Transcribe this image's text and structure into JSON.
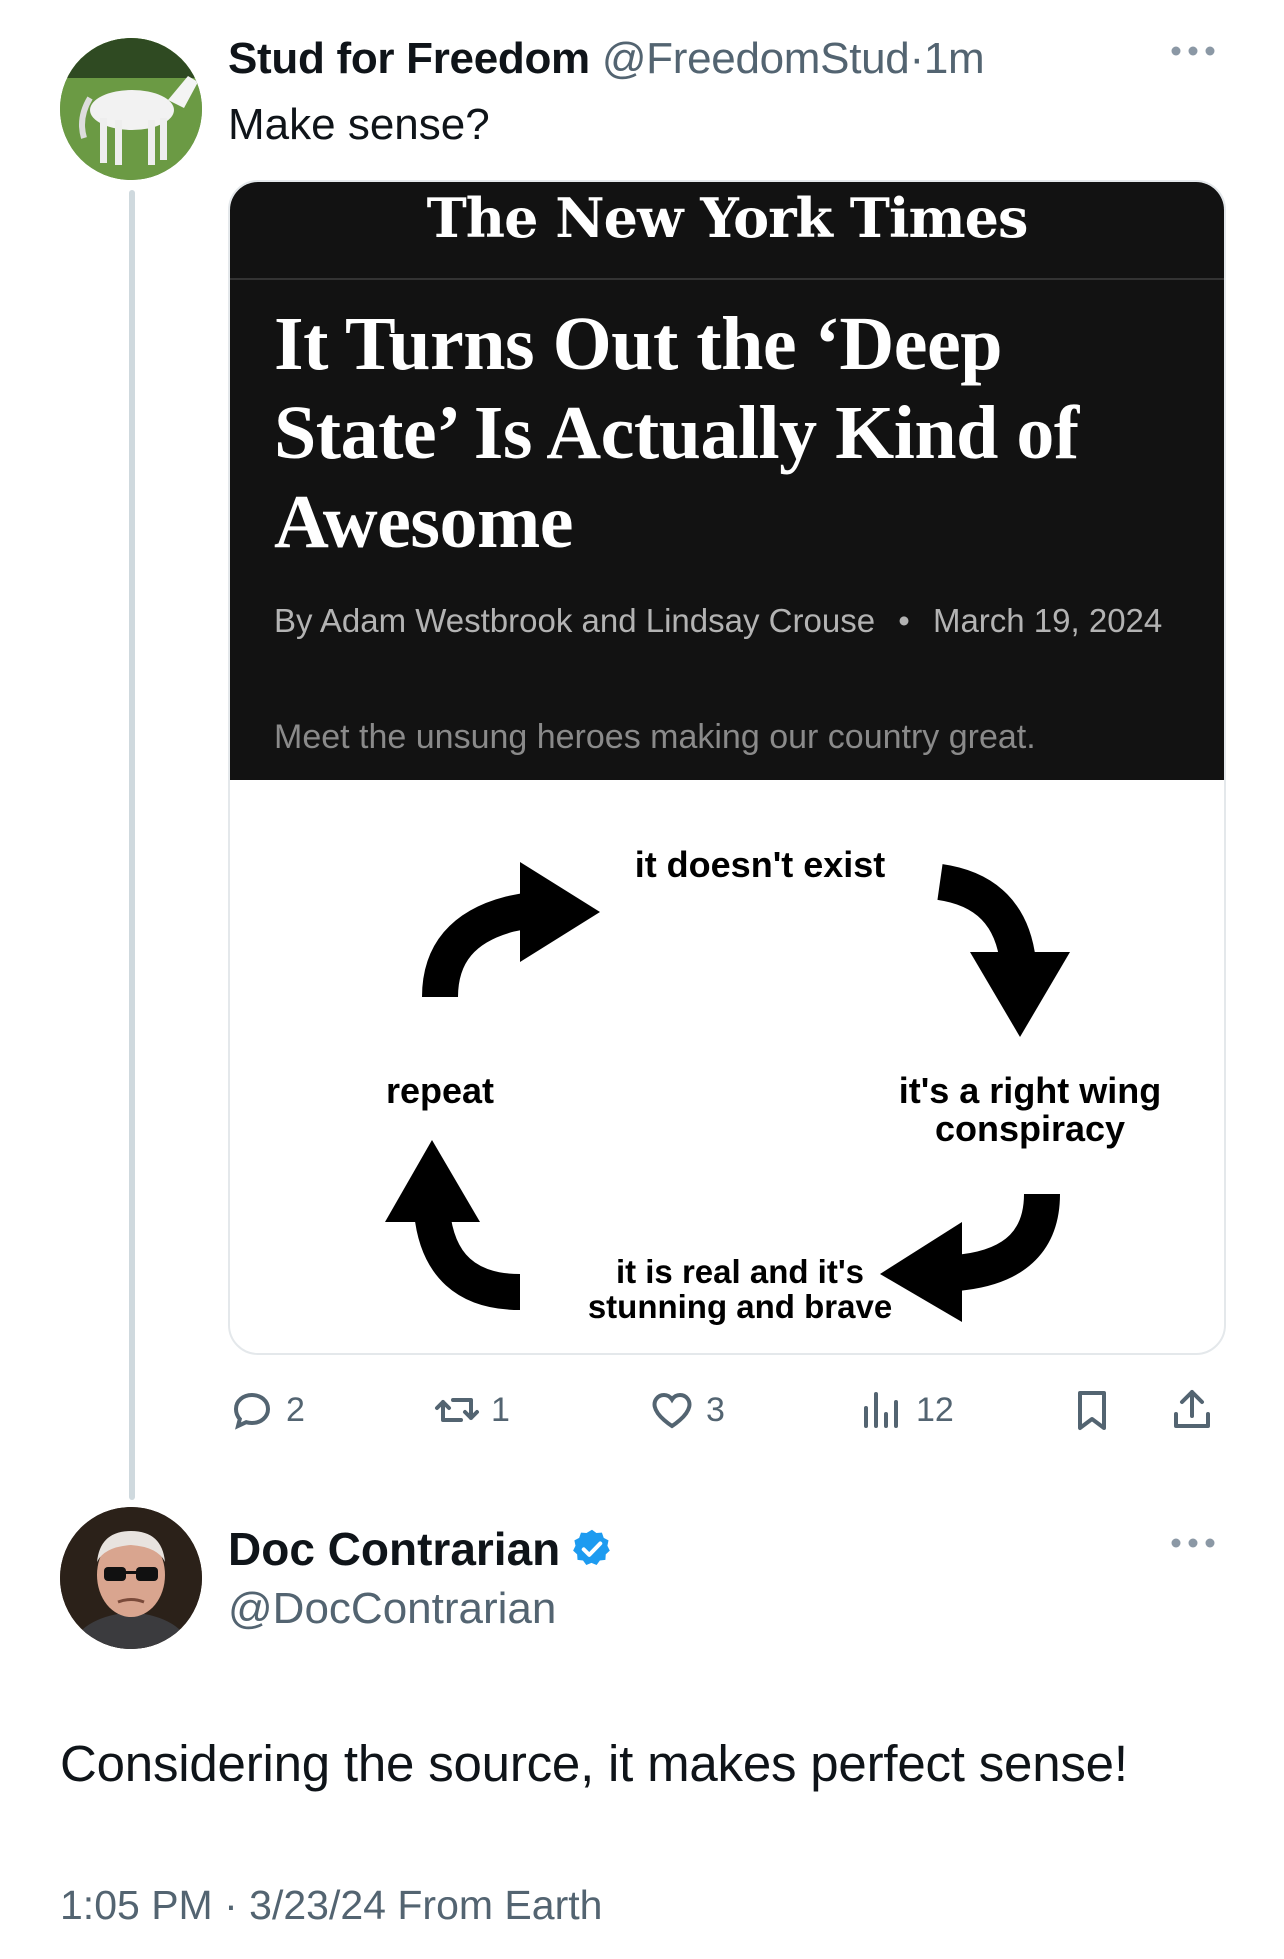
{
  "tweet1": {
    "display_name": "Stud for Freedom",
    "handle": "@FreedomStud",
    "separator": "·",
    "time": "1m",
    "text": "Make sense?",
    "more_icon": "ellipsis-icon",
    "card": {
      "publication": "The New York Times",
      "headline": "It Turns Out the ‘Deep State’ Is Actually Kind of Awesome",
      "byline": "By Adam Westbrook and Lindsay Crouse",
      "bullet": "•",
      "date": "March 19, 2024",
      "dek": "Meet the unsung heroes making our country great.",
      "cycle": {
        "top": "it doesn't exist",
        "right": "it's a right wing conspiracy",
        "bottom": "it is real and it's stunning and brave",
        "left": "repeat"
      }
    },
    "actions": {
      "replies": "2",
      "reposts": "1",
      "likes": "3",
      "views": "12"
    }
  },
  "tweet2": {
    "display_name": "Doc Contrarian",
    "verified_icon": "verified-badge-icon",
    "handle": "@DocContrarian",
    "text": "Considering the source, it makes perfect sense!",
    "time": "1:05 PM",
    "separator": "·",
    "date": "3/23/24",
    "location": "From Earth"
  },
  "colors": {
    "text_primary": "#0f1419",
    "text_secondary": "#536471",
    "verified": "#1d9bf0",
    "card_dark": "#121212"
  }
}
